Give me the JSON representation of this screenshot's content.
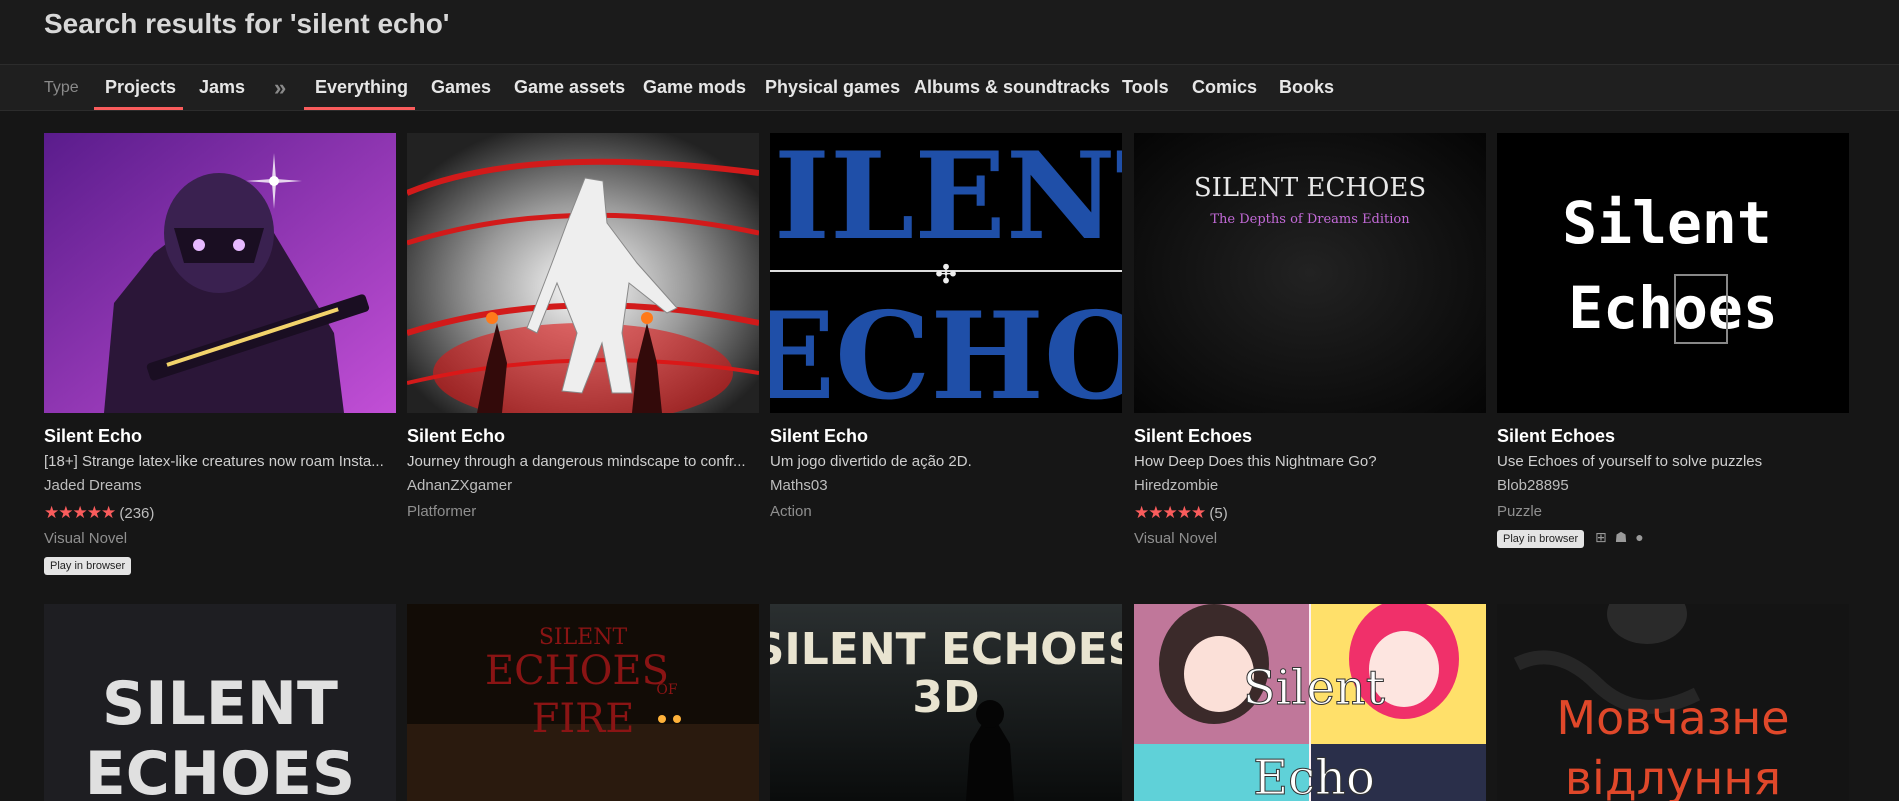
{
  "header": {
    "title": "Search results for 'silent echo'"
  },
  "tabs": {
    "type_label": "Type",
    "projects": "Projects",
    "jams": "Jams",
    "separator": "»",
    "everything": "Everything",
    "games": "Games",
    "game_assets": "Game assets",
    "game_mods": "Game mods",
    "physical_games": "Physical games",
    "albums": "Albums & soundtracks",
    "tools": "Tools",
    "comics": "Comics",
    "books": "Books"
  },
  "colors": {
    "accent": "#fa5c5c",
    "background": "#161616"
  },
  "cards": [
    {
      "title": "Silent Echo",
      "description": "[18+] Strange latex-like creatures now roam Insta...",
      "author": "Jaded Dreams",
      "stars": "★★★★★",
      "rating_count": "(236)",
      "genre": "Visual Novel",
      "badge": "Play in browser"
    },
    {
      "title": "Silent Echo",
      "description": "Journey through a dangerous mindscape to confr...",
      "author": "AdnanZXgamer",
      "genre": "Platformer"
    },
    {
      "title": "Silent Echo",
      "description": "Um jogo divertido de ação 2D.",
      "author": "Maths03",
      "genre": "Action",
      "art_text_1": "SILENT",
      "art_text_2": "ECHO"
    },
    {
      "title": "Silent Echoes",
      "description": "How Deep Does this Nightmare Go?",
      "author": "Hiredzombie",
      "stars": "★★★★★",
      "rating_count": "(5)",
      "genre": "Visual Novel",
      "art_text_1": "SILENT ECHOES",
      "art_text_2": "The Depths of Dreams Edition"
    },
    {
      "title": "Silent Echoes",
      "description": "Use Echoes of yourself to solve puzzles",
      "author": "Blob28895",
      "genre": "Puzzle",
      "badge": "Play in browser",
      "platform_icons": [
        "windows-icon",
        "linux-icon",
        "apple-icon"
      ],
      "art_text_1": "Silent",
      "art_text_2": "Echoes"
    }
  ],
  "row2": [
    {
      "art_text_1": "SILENT",
      "art_text_2": "ECHOES"
    },
    {
      "art_text_1": "SILENT",
      "art_text_2": "ECHOES",
      "art_text_3": "FIRE",
      "art_text_4": "OF"
    },
    {
      "art_text_1": "SILENT ECHOES",
      "art_text_2": "3D"
    },
    {
      "art_text_1": "Silent",
      "art_text_2": "Echo"
    },
    {
      "art_text_1": "Мовчазне",
      "art_text_2": "відлуння"
    }
  ]
}
